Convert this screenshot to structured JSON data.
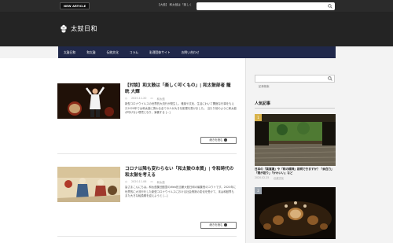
{
  "topbar": {
    "badge": "NEW ARTICLE",
    "ticker": "【大鼓】 和太鼓は「楽しく",
    "search_placeholder": "記事検索"
  },
  "header": {
    "site_title": "太鼓日和"
  },
  "nav": {
    "items": [
      "太鼓日和",
      "和太鼓",
      "伝統文化",
      "コラム",
      "彩運団体サイト",
      "お問い合わせ"
    ]
  },
  "articles": [
    {
      "title": "【対談】和太鼓は「楽しく叩くもの」| 和太鼓部者 籠 晄 大輝",
      "date": "2020.11.20",
      "category": "和太鼓",
      "excerpt": "新型コロナウイルスの世界的大流行が発生し、雅楽や文化、生活にわいて開館な行事をもえた2020年では和太鼓に携わる全ての人が大きな影響を受けました。 当たり前のように和太鼓が叩けない環境となり、演奏する [...]",
      "read_more": "続きを読む"
    },
    {
      "title": "コロナ以降も変わらない「和太鼓の本質」| 令和時代の和太鼓を考える",
      "date": "2020.11.06",
      "category": "和太鼓",
      "excerpt": "皆さまこんにちは。和太鼓集団鼓童のWeb担当兼大鼓日和の編集長のユウトです。2020年に世界的に大流行をした新型コロナウイルスにおける社会情勢の変化を受けて、末は和鼓界もまた大きな転換期を迎えようと [...]",
      "read_more": "続きを読む"
    }
  ],
  "sidebar": {
    "search_placeholder": "記事検索",
    "popular_title": "人気記事",
    "popular": [
      {
        "rank": "1",
        "title": "日本の「美意識」や「和の精神」説明できますか？「余白力」「間が語り」「かわいい」など",
        "date": "2020.02.25",
        "category": "伝統文化"
      },
      {
        "rank": "2",
        "title": "",
        "date": "",
        "category": ""
      }
    ]
  },
  "colors": {
    "topbar": "#2b2b2b",
    "header": "#242424",
    "nav": "#20284a",
    "rank1": "#d8b24a"
  }
}
